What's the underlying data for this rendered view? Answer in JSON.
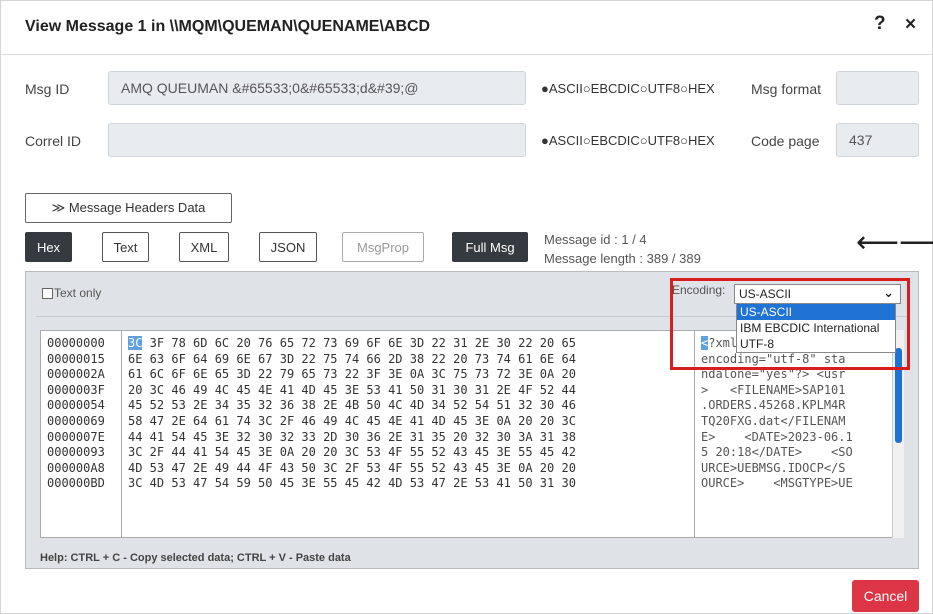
{
  "title": "View Message 1 in \\\\MQM\\QUEMAN\\QUENAME\\ABCD",
  "help_glyph": "?",
  "close_glyph": "×",
  "msg_id": {
    "label": "Msg ID",
    "value": "AMQ QUEUMAN  &#65533;0&#65533;d&#39;@",
    "radios": "●ASCII○EBCDIC○UTF8○HEX",
    "format_label": "Msg format",
    "format_value": ""
  },
  "correl_id": {
    "label": "Correl ID",
    "value": "",
    "radios": "●ASCII○EBCDIC○UTF8○HEX",
    "codepage_label": "Code page",
    "codepage_value": "437"
  },
  "headers_button": "≫ Message Headers Data",
  "view_buttons": [
    "Hex",
    "Text",
    "XML",
    "JSON",
    "MsgProp",
    "Full Msg"
  ],
  "message_info": {
    "id": "Message id : 1 / 4",
    "length": "Message length : 389 / 389"
  },
  "nav_arrows": "⟵⟶",
  "panel": {
    "text_only_label": "Text only",
    "encoding_label": "Encoding:",
    "encoding_selected": "US-ASCII",
    "encoding_options": [
      "US-ASCII",
      "IBM EBCDIC International",
      "UTF-8"
    ]
  },
  "hex_rows": [
    {
      "addr": "00000000",
      "hex": "3C 3F 78 6D 6C 20 76 65 72 73 69 6F 6E 3D 22 31 2E 30 22 20 65",
      "ascii": "<?xml version=\"1.0\" e"
    },
    {
      "addr": "00000015",
      "hex": "6E 63 6F 64 69 6E 67 3D 22 75 74 66 2D 38 22 20 73 74 61 6E 64",
      "ascii": "encoding=\"utf-8\" sta"
    },
    {
      "addr": "0000002A",
      "hex": "61 6C 6F 6E 65 3D 22 79 65 73 22 3F 3E 0A 3C 75 73 72 3E 0A 20",
      "ascii": "ndalone=\"yes\"?> <usr"
    },
    {
      "addr": "0000003F",
      "hex": "20 3C 46 49 4C 45 4E 41 4D 45 3E 53 41 50 31 30 31 2E 4F 52 44",
      "ascii": ">   <FILENAME>SAP101"
    },
    {
      "addr": "00000054",
      "hex": "45 52 53 2E 34 35 32 36 38 2E 4B 50 4C 4D 34 52 54 51 32 30 46",
      "ascii": ".ORDERS.45268.KPLM4R"
    },
    {
      "addr": "00000069",
      "hex": "58 47 2E 64 61 74 3C 2F 46 49 4C 45 4E 41 4D 45 3E 0A 20 20 3C",
      "ascii": "TQ20FXG.dat</FILENAM"
    },
    {
      "addr": "0000007E",
      "hex": "44 41 54 45 3E 32 30 32 33 2D 30 36 2E 31 35 20 32 30 3A 31 38",
      "ascii": "E>    <DATE>2023-06.1"
    },
    {
      "addr": "00000093",
      "hex": "3C 2F 44 41 54 45 3E 0A 20 20 3C 53 4F 55 52 43 45 3E 55 45 42",
      "ascii": "5 20:18</DATE>    <SO"
    },
    {
      "addr": "000000A8",
      "hex": "4D 53 47 2E 49 44 4F 43 50 3C 2F 53 4F 55 52 43 45 3E 0A 20 20",
      "ascii": "URCE>UEBMSG.IDOCP</S"
    },
    {
      "addr": "000000BD",
      "hex": "3C 4D 53 47 54 59 50 45 3E 55 45 42 4D 53 47 2E 53 41 50 31 30",
      "ascii": "OURCE>    <MSGTYPE>UE"
    }
  ],
  "help_text": "Help: CTRL + C - Copy selected data; CTRL + V - Paste data",
  "cancel_label": "Cancel",
  "colors": {
    "dark_button": "#343a40",
    "cancel": "#dc3545",
    "selection": "#1e73d3",
    "highlight_box": "#d61e1e"
  }
}
